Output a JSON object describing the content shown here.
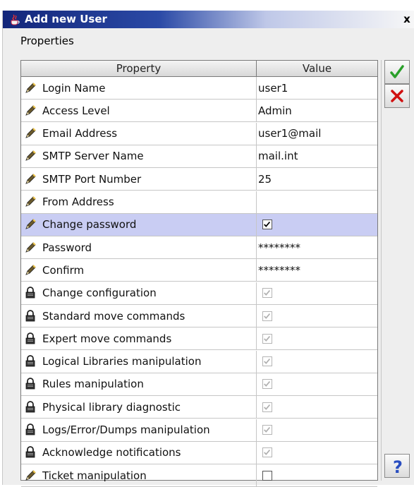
{
  "window": {
    "title": "Add new User",
    "close_label": "x"
  },
  "section_label": "Properties",
  "table": {
    "headers": {
      "property": "Property",
      "value": "Value"
    },
    "rows": [
      {
        "label": "Login Name",
        "icon": "pencil-icon",
        "value": "user1",
        "kind": "text"
      },
      {
        "label": "Access Level",
        "icon": "pencil-icon",
        "value": "Admin",
        "kind": "text"
      },
      {
        "label": "Email Address",
        "icon": "pencil-icon",
        "value": "user1@mail",
        "kind": "text"
      },
      {
        "label": "SMTP Server Name",
        "icon": "pencil-icon",
        "value": "mail.int",
        "kind": "text"
      },
      {
        "label": "SMTP Port Number",
        "icon": "pencil-icon",
        "value": "25",
        "kind": "text"
      },
      {
        "label": "From Address",
        "icon": "pencil-icon",
        "value": "",
        "kind": "text"
      },
      {
        "label": "Change password",
        "icon": "pencil-icon",
        "kind": "checkbox",
        "checked": true,
        "enabled": true,
        "selected": true
      },
      {
        "label": "Password",
        "icon": "pencil-icon",
        "value": "********",
        "kind": "text"
      },
      {
        "label": "Confirm",
        "icon": "pencil-icon",
        "value": "********",
        "kind": "text"
      },
      {
        "label": "Change configuration",
        "icon": "lock-icon",
        "kind": "checkbox",
        "checked": true,
        "enabled": false
      },
      {
        "label": "Standard move commands",
        "icon": "lock-icon",
        "kind": "checkbox",
        "checked": true,
        "enabled": false
      },
      {
        "label": "Expert move commands",
        "icon": "lock-icon",
        "kind": "checkbox",
        "checked": true,
        "enabled": false
      },
      {
        "label": "Logical Libraries manipulation",
        "icon": "lock-icon",
        "kind": "checkbox",
        "checked": true,
        "enabled": false
      },
      {
        "label": "Rules manipulation",
        "icon": "lock-icon",
        "kind": "checkbox",
        "checked": true,
        "enabled": false
      },
      {
        "label": "Physical library diagnostic",
        "icon": "lock-icon",
        "kind": "checkbox",
        "checked": true,
        "enabled": false
      },
      {
        "label": "Logs/Error/Dumps manipulation",
        "icon": "lock-icon",
        "kind": "checkbox",
        "checked": true,
        "enabled": false
      },
      {
        "label": "Acknowledge notifications",
        "icon": "lock-icon",
        "kind": "checkbox",
        "checked": true,
        "enabled": false
      },
      {
        "label": "Ticket manipulation",
        "icon": "pencil-icon",
        "kind": "checkbox",
        "checked": false,
        "enabled": true
      }
    ]
  },
  "side_buttons": [
    {
      "name": "ok-button",
      "icon": "checkmark-icon",
      "color": "#2aa02a"
    },
    {
      "name": "cancel-button",
      "icon": "red-x-icon",
      "color": "#d01010"
    },
    {
      "name": "help-button",
      "icon": "question-mark-icon",
      "color": "#2a4ec0"
    }
  ],
  "colors": {
    "title_dark": "#13267a",
    "selection": "#c9cdf3"
  }
}
